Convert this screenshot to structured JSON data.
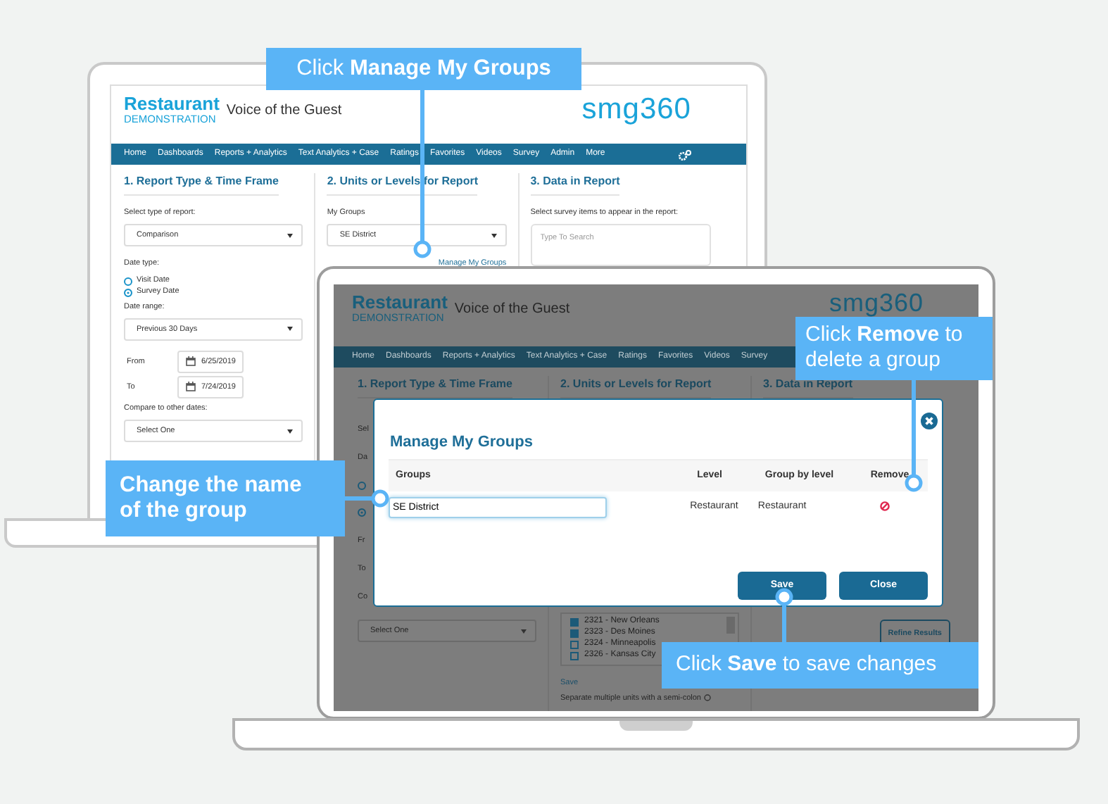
{
  "callouts": [
    {
      "text": "Click **Manage My Groups**",
      "bold": false
    },
    {
      "text": "Change the name of the group",
      "bold": true
    },
    {
      "text": "Click **Remove** to delete a group",
      "bold": false
    },
    {
      "text": "Click **Save** to save changes",
      "bold": false
    }
  ],
  "back_screen": {
    "header": {
      "brand": "Restaurant",
      "brand_sub": "DEMONSTRATION",
      "title": "Voice of the Guest",
      "logo": "smg360"
    },
    "nav": [
      "Home",
      "Dashboards",
      "Reports + Analytics",
      "Text Analytics + Case",
      "Ratings",
      "Favorites",
      "Videos",
      "Survey",
      "Admin",
      "More"
    ],
    "nav_gear": true,
    "columns": [
      {
        "heading": "1.  Report Type & Time Frame",
        "items": [
          {
            "kind": "label",
            "text": "Select type of report:"
          },
          {
            "kind": "select",
            "text": "Comparison"
          },
          {
            "kind": "label",
            "text": "Date type:"
          },
          {
            "kind": "radio",
            "text": "Visit Date",
            "selected": false
          },
          {
            "kind": "radio",
            "text": "Survey Date",
            "selected": true
          },
          {
            "kind": "label",
            "text": "Date range:"
          },
          {
            "kind": "select",
            "text": "Previous 30 Days"
          },
          {
            "kind": "date",
            "label": "From",
            "text": "6/25/2019"
          },
          {
            "kind": "date",
            "label": "To",
            "text": "7/24/2019"
          },
          {
            "kind": "label",
            "text": "Compare to other dates:"
          },
          {
            "kind": "select",
            "text": "Select One"
          }
        ]
      },
      {
        "heading": "2. Units or Levels for Report",
        "items": [
          {
            "kind": "label",
            "text": "My Groups"
          },
          {
            "kind": "select",
            "text": "SE District"
          },
          {
            "kind": "link",
            "text": "Manage My Groups"
          }
        ]
      },
      {
        "heading": "3. Data in Report",
        "items": [
          {
            "kind": "label",
            "text": "Select survey items to appear in the report:"
          },
          {
            "kind": "search",
            "placeholder": "Type To Search"
          }
        ]
      }
    ]
  },
  "front_screen": {
    "header": {
      "brand": "Restaurant",
      "brand_sub": "DEMONSTRATION",
      "title": "Voice of the Guest",
      "logo": "smg360"
    },
    "nav": [
      "Home",
      "Dashboards",
      "Reports + Analytics",
      "Text Analytics + Case",
      "Ratings",
      "Favorites",
      "Videos",
      "Survey"
    ],
    "columns": [
      {
        "heading": "1.  Report Type & Time Frame",
        "items": [
          {
            "kind": "label",
            "text": "Sel"
          },
          {
            "kind": "label",
            "text": "Da"
          },
          {
            "kind": "radio",
            "selected": false
          },
          {
            "kind": "radio",
            "selected": true
          },
          {
            "kind": "label",
            "text": "Fr"
          },
          {
            "kind": "label",
            "text": "To"
          },
          {
            "kind": "label",
            "text": "Co"
          },
          {
            "kind": "select",
            "text": "Select One"
          }
        ]
      },
      {
        "heading": "2. Units or Levels for Report",
        "items": [
          {
            "kind": "checklist",
            "entries": [
              {
                "text": "2321 - New Orleans",
                "checked": true
              },
              {
                "text": "2323 - Des Moines",
                "checked": true
              },
              {
                "text": "2324 - Minneapolis",
                "checked": false
              },
              {
                "text": "2326 - Kansas City",
                "checked": false
              }
            ]
          },
          {
            "kind": "link",
            "text": "Save"
          },
          {
            "kind": "hint",
            "text": "Separate multiple units with a semi-colon"
          }
        ]
      },
      {
        "heading": "3. Data in Report",
        "items": [
          {
            "kind": "button",
            "text": "Refine Results"
          }
        ]
      }
    ],
    "modal": {
      "title": "Manage My Groups",
      "columns": [
        "Groups",
        "Level",
        "Group by level",
        "Remove"
      ],
      "rows": [
        {
          "group": "SE District",
          "level": "Restaurant",
          "group_by_level": "Restaurant"
        }
      ],
      "buttons": [
        "Save",
        "Close"
      ]
    }
  }
}
